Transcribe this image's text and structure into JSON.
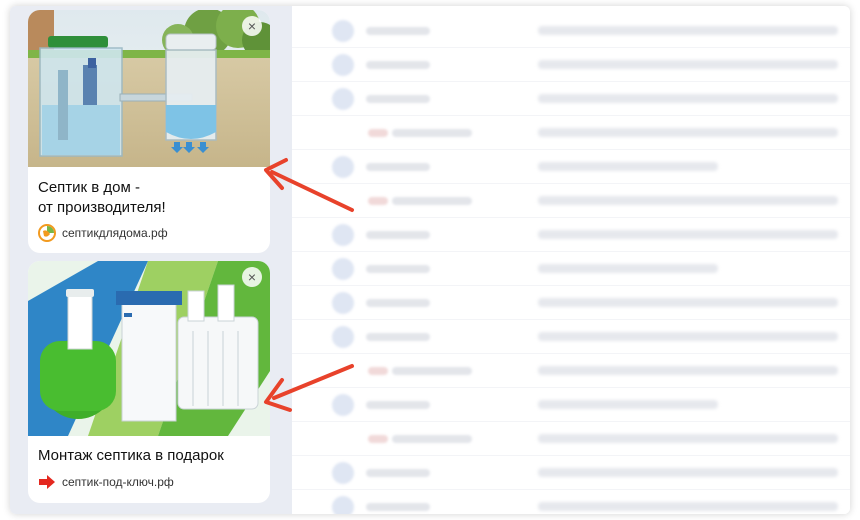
{
  "ads": [
    {
      "title": "Септик в дом -\nот производителя!",
      "domain": "септикдлядома.рф",
      "close_label": "×",
      "favicon": "orange-green-circle-icon"
    },
    {
      "title": "Монтаж септика в подарок",
      "domain": "септик-под-ключ.рф",
      "close_label": "×",
      "favicon": "red-arrow-icon"
    }
  ],
  "colors": {
    "sidebar_bg": "#e9ecf3",
    "arrow": "#e8422b"
  }
}
